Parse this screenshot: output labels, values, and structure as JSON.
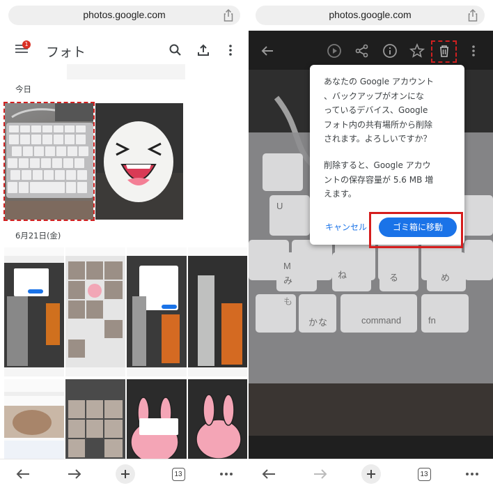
{
  "browser": {
    "url": "photos.google.com",
    "tab_count": "13",
    "icons": [
      "share-icon",
      "back-arrow-icon",
      "forward-arrow-icon",
      "plus-icon",
      "tabs-icon",
      "more-icon"
    ]
  },
  "left": {
    "header": {
      "title": "フォト",
      "notification_count": "1",
      "icons": [
        "menu-icon",
        "search-icon",
        "upload-icon",
        "more-vert-icon"
      ]
    },
    "sections": [
      {
        "label": "今日"
      },
      {
        "label": "6月21日(金)"
      }
    ]
  },
  "right": {
    "toolbar_icons": [
      "back-arrow-icon",
      "play-icon",
      "share-icon",
      "info-icon",
      "star-icon",
      "trash-icon",
      "more-vert-icon"
    ],
    "dialog": {
      "message": "あなたの Google アカウント、バックアップがオンになっているデバイス、Google フォト内の共有場所から削除されます。よろしいですか？",
      "message_lines": [
        "あなたの Google アカウント",
        "、バックアップがオンにな",
        "っているデバイス、Google",
        "フォト内の共有場所から削除",
        "されます。よろしいですか？"
      ],
      "note_lines": [
        "削除すると、Google アカウ",
        "ントの保存容量が 5.6 MB 増",
        "えます。"
      ],
      "cancel_label": "キャンセル",
      "confirm_label": "ゴミ箱に移動"
    },
    "keyboard_labels": [
      "U",
      "M",
      "み",
      "も",
      "ね",
      "る",
      "め",
      "command",
      "fn",
      "か",
      "な"
    ]
  },
  "colors": {
    "accent_blue": "#1a73e8",
    "highlight_red": "#d51d1d",
    "badge_red": "#d93025"
  }
}
